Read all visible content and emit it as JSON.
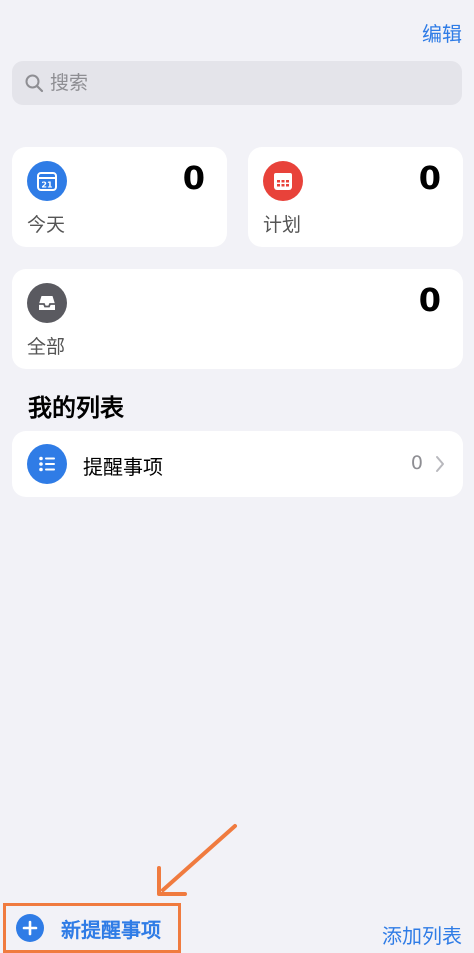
{
  "header": {
    "edit_label": "编辑"
  },
  "search": {
    "placeholder": "搜索",
    "icon": "search-icon"
  },
  "smart_lists": [
    {
      "id": "today",
      "label": "今天",
      "count": "0",
      "icon": "calendar-today-icon",
      "icon_text": "21",
      "color": "#2f7ce6"
    },
    {
      "id": "scheduled",
      "label": "计划",
      "count": "0",
      "icon": "calendar-scheduled-icon",
      "color": "#e8423a"
    },
    {
      "id": "all",
      "label": "全部",
      "count": "0",
      "icon": "tray-icon",
      "color": "#5a5a60"
    }
  ],
  "my_lists": {
    "title": "我的列表",
    "items": [
      {
        "name": "提醒事项",
        "count": "0",
        "icon": "list-bullet-icon",
        "color": "#2f7ce6"
      }
    ]
  },
  "bottom_bar": {
    "new_reminder_label": "新提醒事项",
    "add_list_label": "添加列表",
    "highlight_color": "#f07b3f"
  },
  "colors": {
    "accent": "#2f7ce6",
    "background": "#f2f2f7",
    "annotation": "#f07b3f"
  }
}
